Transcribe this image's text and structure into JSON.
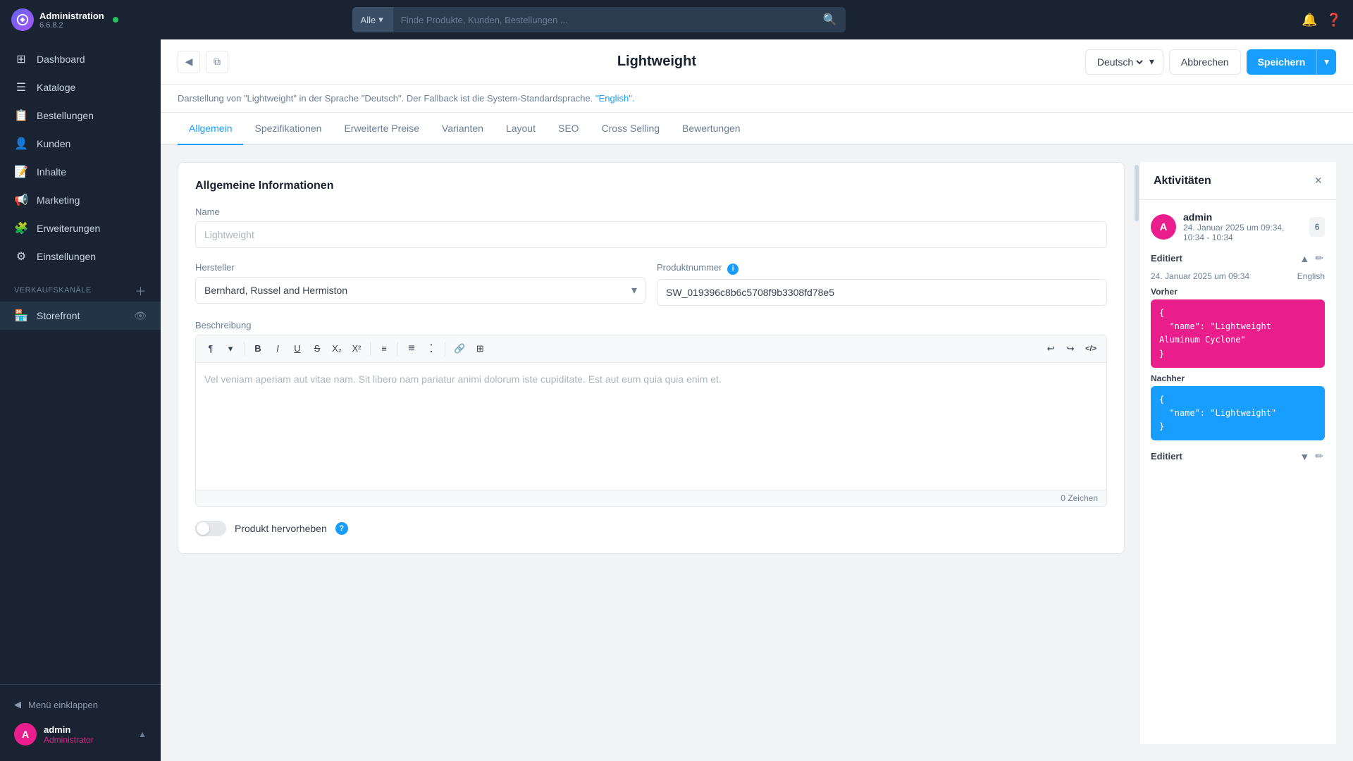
{
  "app": {
    "name": "Administration",
    "version": "6.6.8.2"
  },
  "topbar": {
    "search_placeholder": "Finde Produkte, Kunden, Bestellungen ...",
    "search_filter": "Alle"
  },
  "sidebar": {
    "nav_items": [
      {
        "id": "dashboard",
        "label": "Dashboard",
        "icon": "⊞"
      },
      {
        "id": "kataloge",
        "label": "Kataloge",
        "icon": "☰"
      },
      {
        "id": "bestellungen",
        "label": "Bestellungen",
        "icon": "📋"
      },
      {
        "id": "kunden",
        "label": "Kunden",
        "icon": "👤"
      },
      {
        "id": "inhalte",
        "label": "Inhalte",
        "icon": "📝"
      },
      {
        "id": "marketing",
        "label": "Marketing",
        "icon": "📢"
      },
      {
        "id": "erweiterungen",
        "label": "Erweiterungen",
        "icon": "🧩"
      },
      {
        "id": "einstellungen",
        "label": "Einstellungen",
        "icon": "⚙"
      }
    ],
    "section_label": "Verkaufskanäle",
    "channel_items": [
      {
        "id": "storefront",
        "label": "Storefront"
      }
    ],
    "collapse_label": "Menü einklappen",
    "user_name": "admin",
    "user_role": "Administrator"
  },
  "page": {
    "title": "Lightweight",
    "language": "Deutsch",
    "btn_cancel": "Abbrechen",
    "btn_save": "Speichern"
  },
  "info_bar": {
    "text_before": "Darstellung von \"Lightweight\" in der Sprache \"Deutsch\". Der Fallback ist die System-Standardsprache.",
    "link_text": "\"English\"."
  },
  "tabs": [
    {
      "id": "allgemein",
      "label": "Allgemein",
      "active": true
    },
    {
      "id": "spezifikationen",
      "label": "Spezifikationen"
    },
    {
      "id": "erweiterte-preise",
      "label": "Erweiterte Preise"
    },
    {
      "id": "varianten",
      "label": "Varianten"
    },
    {
      "id": "layout",
      "label": "Layout"
    },
    {
      "id": "seo",
      "label": "SEO"
    },
    {
      "id": "cross-selling",
      "label": "Cross Selling"
    },
    {
      "id": "bewertungen",
      "label": "Bewertungen"
    }
  ],
  "form": {
    "section_title": "Allgemeine Informationen",
    "name_label": "Name",
    "name_placeholder": "Lightweight",
    "hersteller_label": "Hersteller",
    "hersteller_value": "Bernhard, Russel and Hermiston",
    "produktnummer_label": "Produktnummer",
    "produktnummer_value": "SW_019396c8b6c5708f9b3308fd78e5",
    "beschreibung_label": "Beschreibung",
    "beschreibung_placeholder": "Vel veniam aperiam aut vitae nam. Sit libero nam pariatur animi dolorum iste cupiditate. Est aut eum quia quia enim et.",
    "zeichen_count": "0 Zeichen",
    "produkt_hervorheben_label": "Produkt hervorheben"
  },
  "toolbar_buttons": [
    {
      "id": "paragraph",
      "label": "¶"
    },
    {
      "id": "format",
      "label": "❡"
    },
    {
      "id": "bold",
      "label": "B"
    },
    {
      "id": "italic",
      "label": "I"
    },
    {
      "id": "underline",
      "label": "U"
    },
    {
      "id": "strikethrough",
      "label": "S̶"
    },
    {
      "id": "subscript",
      "label": "X₂"
    },
    {
      "id": "superscript",
      "label": "X²"
    },
    {
      "id": "align",
      "label": "≡"
    },
    {
      "id": "ol",
      "label": "≣"
    },
    {
      "id": "ul",
      "label": "⁞"
    },
    {
      "id": "link",
      "label": "🔗"
    },
    {
      "id": "table",
      "label": "⊞"
    },
    {
      "id": "undo",
      "label": "↩"
    },
    {
      "id": "redo",
      "label": "↪"
    },
    {
      "id": "html",
      "label": "</>"
    }
  ],
  "activity": {
    "panel_title": "Aktivitäten",
    "user_name": "admin",
    "user_date": "24. Januar 2025 um 09:34, 10:34 - 10:34",
    "badge_count": "6",
    "section1": {
      "title": "Editiert",
      "date": "24. Januar 2025 um 09:34",
      "lang": "English",
      "before_label": "Vorher",
      "before_code": "{\n  \"name\": \"Lightweight Aluminum Cyclone\"\n}",
      "after_label": "Nachher",
      "after_code": "{\n  \"name\": \"Lightweight\"\n}"
    },
    "section2": {
      "title": "Editiert"
    }
  }
}
